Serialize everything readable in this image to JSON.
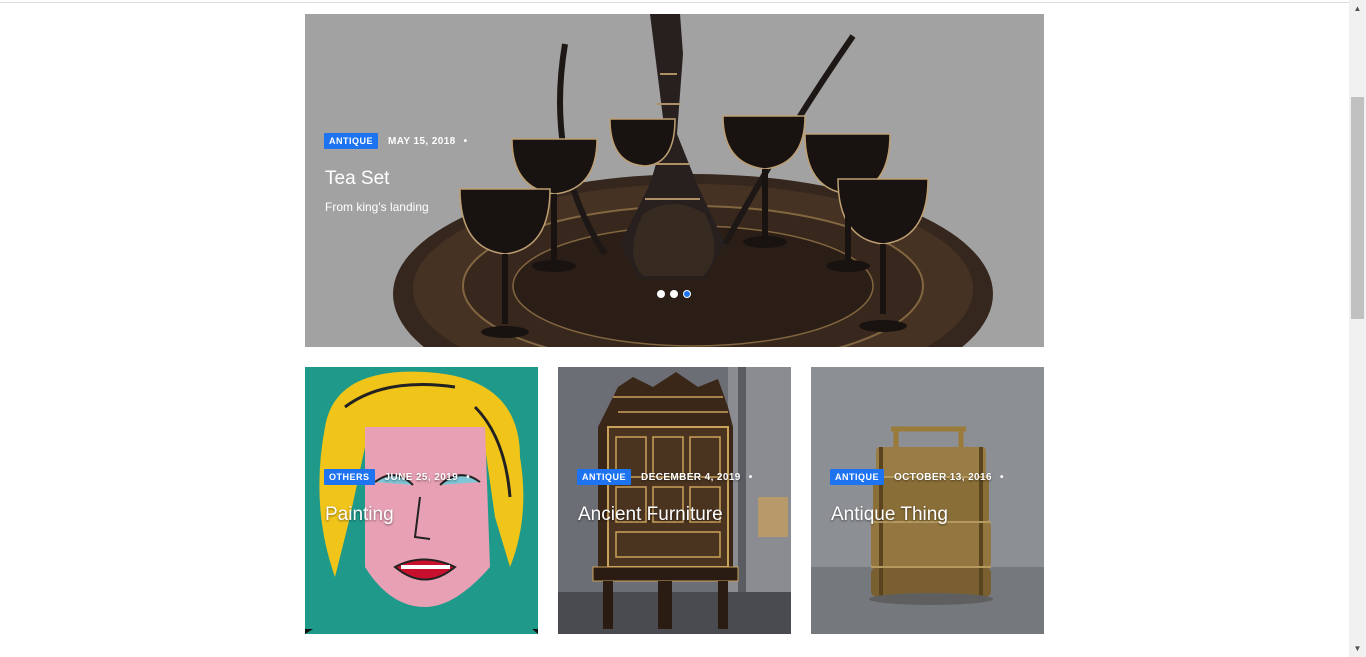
{
  "hero": {
    "category": "ANTIQUE",
    "date": "MAY 15, 2018",
    "separator": "•",
    "title": "Tea Set",
    "subtitle": "From king's landing",
    "slides": 3,
    "active_slide": 3
  },
  "cards": [
    {
      "category": "OTHERS",
      "date": "JUNE 25, 2019",
      "separator": "•",
      "title": "Painting"
    },
    {
      "category": "ANTIQUE",
      "date": "DECEMBER 4, 2019",
      "separator": "•",
      "title": "Ancient Furniture"
    },
    {
      "category": "ANTIQUE",
      "date": "OCTOBER 13, 2016",
      "separator": "•",
      "title": "Antique Thing"
    }
  ],
  "scrollbar": {
    "up_icon": "▲",
    "down_icon": "▼"
  },
  "colors": {
    "accent": "#1e73f0"
  }
}
